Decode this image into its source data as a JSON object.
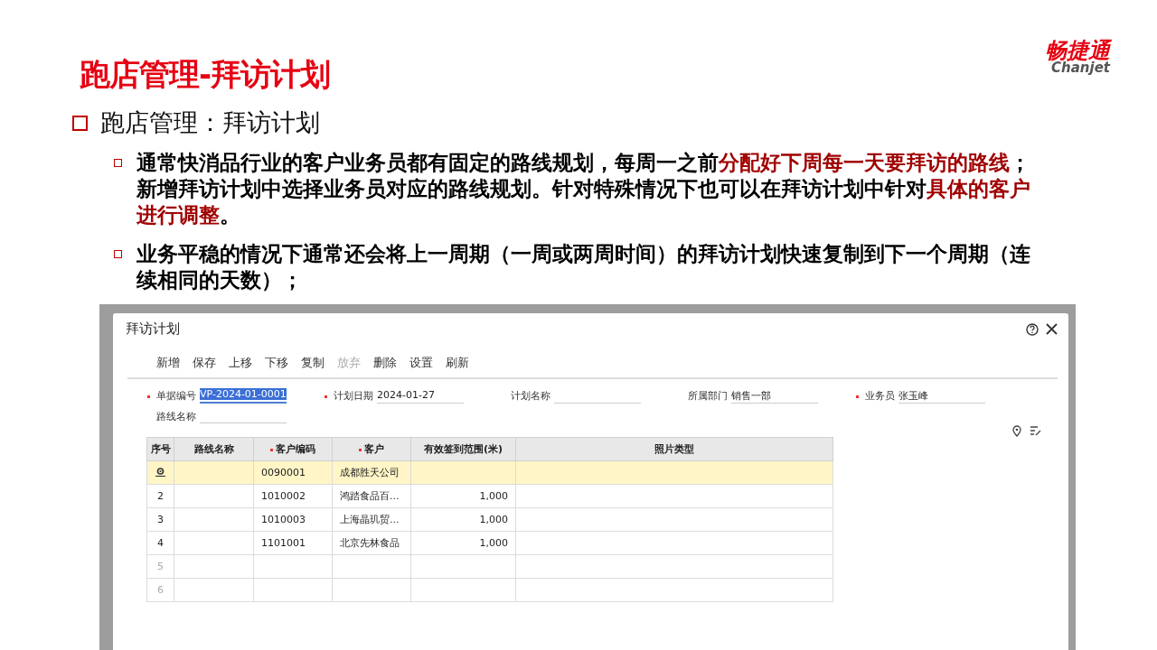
{
  "slide": {
    "title": "跑店管理-拜访计划",
    "logo": {
      "name": "畅捷通",
      "latin": "Chanjet"
    },
    "heading": "跑店管理：拜访计划",
    "bullets": [
      {
        "segments": [
          {
            "text": "通常快消品行业的客户业务员都有固定的路线规划，每周一之前",
            "highlight": false
          },
          {
            "text": "分配好下周每一天要拜访的路线",
            "highlight": true
          },
          {
            "text": "；新增拜访计划中选择业务员对应的路线规划。针对特殊情况下也可以在拜访计划中针对",
            "highlight": false
          },
          {
            "text": "具体的客户进行调整",
            "highlight": true
          },
          {
            "text": "。",
            "highlight": false
          }
        ]
      },
      {
        "segments": [
          {
            "text": "业务平稳的情况下通常还会将上一周期（一周或两周时间）的拜访计划快速复制到下一个周期（连续相同的天数）；",
            "highlight": false
          }
        ]
      }
    ]
  },
  "dialog": {
    "title": "拜访计划",
    "toolbar": [
      {
        "label": "新增",
        "disabled": false
      },
      {
        "label": "保存",
        "disabled": false
      },
      {
        "label": "上移",
        "disabled": false
      },
      {
        "label": "下移",
        "disabled": false
      },
      {
        "label": "复制",
        "disabled": false
      },
      {
        "label": "放弃",
        "disabled": true
      },
      {
        "label": "删除",
        "disabled": false
      },
      {
        "label": "设置",
        "disabled": false
      },
      {
        "label": "刷新",
        "disabled": false
      }
    ],
    "fields": [
      {
        "label": "单据编号",
        "value": "VP-2024-01-0001",
        "required": true,
        "text_selected": true
      },
      {
        "label": "计划日期",
        "value": "2024-01-27",
        "required": true,
        "text_selected": false
      },
      {
        "label": "计划名称",
        "required": false,
        "text_selected": false
      },
      {
        "label": "所属部门",
        "value": "销售一部",
        "required": false,
        "text_selected": false
      },
      {
        "label": "业务员",
        "value": "张玉峰",
        "required": true,
        "text_selected": false
      },
      {
        "label": "路线名称",
        "required": false,
        "text_selected": false
      }
    ],
    "table": {
      "columns": [
        {
          "label": "序号",
          "required": false
        },
        {
          "label": "路线名称",
          "required": false
        },
        {
          "label": "客户编码",
          "required": true
        },
        {
          "label": "客户",
          "required": true
        },
        {
          "label": "有效签到范围(米)",
          "required": false
        },
        {
          "label": "照片类型",
          "required": false
        }
      ],
      "rows": [
        {
          "selected": true,
          "cells": [
            "",
            "",
            "0090001",
            "成都胜天公司",
            "",
            ""
          ]
        },
        {
          "selected": false,
          "cells": [
            "2",
            "",
            "1010002",
            "鸿踏食品百...",
            "1,000",
            ""
          ]
        },
        {
          "selected": false,
          "cells": [
            "3",
            "",
            "1010003",
            "上海晶玑贸...",
            "1,000",
            ""
          ]
        },
        {
          "selected": false,
          "cells": [
            "4",
            "",
            "1101001",
            "北京先林食品",
            "1,000",
            ""
          ]
        },
        {
          "selected": false,
          "cells": [
            "5",
            "",
            "",
            "",
            "",
            ""
          ]
        },
        {
          "selected": false,
          "cells": [
            "6",
            "",
            "",
            "",
            "",
            ""
          ]
        }
      ]
    }
  }
}
